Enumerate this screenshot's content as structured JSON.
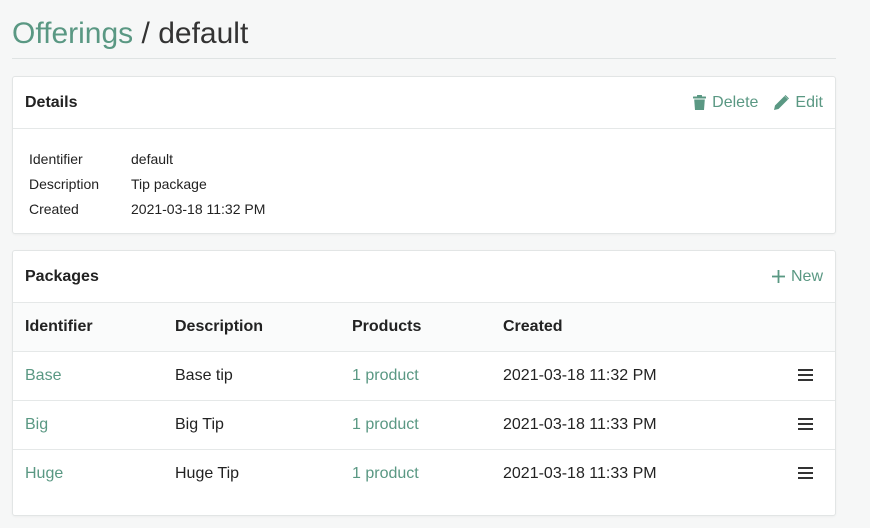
{
  "breadcrumb": {
    "parent": "Offerings",
    "separator": "/",
    "current": "default"
  },
  "details": {
    "title": "Details",
    "delete_label": "Delete",
    "edit_label": "Edit",
    "fields": [
      {
        "label": "Identifier",
        "value": "default"
      },
      {
        "label": "Description",
        "value": "Tip package"
      },
      {
        "label": "Created",
        "value": "2021-03-18 11:32 PM"
      }
    ]
  },
  "packages": {
    "title": "Packages",
    "new_label": "New",
    "columns": [
      "Identifier",
      "Description",
      "Products",
      "Created"
    ],
    "rows": [
      {
        "identifier": "Base",
        "description": "Base tip",
        "products": "1 product",
        "created": "2021-03-18 11:32 PM"
      },
      {
        "identifier": "Big",
        "description": "Big Tip",
        "products": "1 product",
        "created": "2021-03-18 11:33 PM"
      },
      {
        "identifier": "Huge",
        "description": "Huge Tip",
        "products": "1 product",
        "created": "2021-03-18 11:33 PM"
      }
    ]
  },
  "colors": {
    "accent": "#5a9883",
    "text": "#222222",
    "background": "#f6f7f7"
  },
  "icons": {
    "delete": "trash-icon",
    "edit": "pencil-icon",
    "new": "plus-icon",
    "row_menu": "hamburger-menu-icon"
  }
}
